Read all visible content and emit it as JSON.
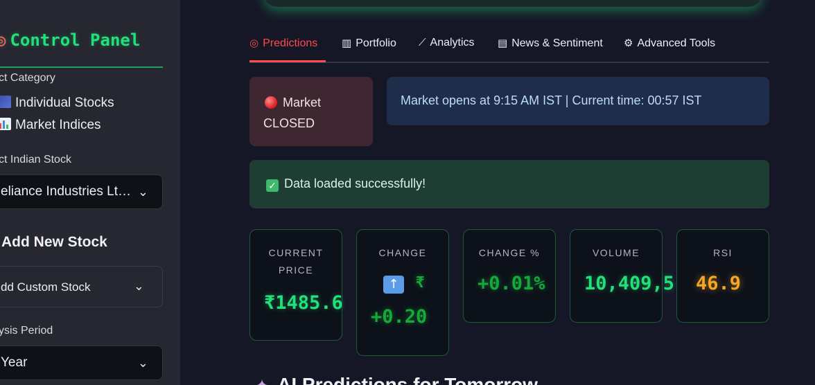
{
  "sidebar": {
    "title": "Control Panel",
    "title_icon": "target-icon",
    "category_label": "ct Category",
    "categories": [
      "Individual Stocks",
      "Market Indices"
    ],
    "stock_label": "ct Indian Stock",
    "stock_selected": "eliance Industries Lt…",
    "add_heading": "Add New Stock",
    "add_expander": "dd Custom Stock",
    "period_label": "ysis Period",
    "period_selected": "Year"
  },
  "tabs": [
    {
      "label": "Predictions",
      "icon": "target-icon",
      "active": true
    },
    {
      "label": "Portfolio",
      "icon": "bar-chart-icon",
      "active": false
    },
    {
      "label": "Analytics",
      "icon": "line-chart-icon",
      "active": false
    },
    {
      "label": "News & Sentiment",
      "icon": "newspaper-icon",
      "active": false
    },
    {
      "label": "Advanced Tools",
      "icon": "gear-icon",
      "active": false
    }
  ],
  "market": {
    "status_line1": "Market",
    "status_line2": "CLOSED",
    "info": "Market opens at 9:15 AM IST | Current time: 00:57 IST"
  },
  "success_message": "Data loaded successfully!",
  "metrics": {
    "price": {
      "label_line1": "CURRENT",
      "label_line2": "PRICE",
      "value": "₹1485.6"
    },
    "change": {
      "label": "CHANGE",
      "currency": "₹",
      "value": "+0.20"
    },
    "change_pct": {
      "label": "CHANGE %",
      "value": "+0.01%"
    },
    "volume": {
      "label": "VOLUME",
      "value": "10,409,5"
    },
    "rsi": {
      "label": "RSI",
      "value": "46.9"
    }
  },
  "next_section_heading": "AI Predictions for Tomorrow",
  "colors": {
    "accent_green": "#22e07a",
    "active_tab": "#ff4b4b",
    "rsi_orange": "#f5a623"
  }
}
